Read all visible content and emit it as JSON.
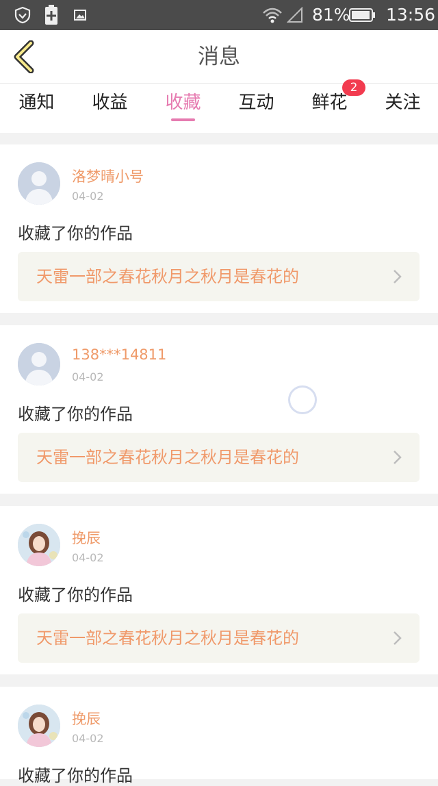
{
  "status_bar": {
    "battery_percent": "81%",
    "time": "13:56",
    "icons": [
      "shield-icon",
      "battery-charging-icon",
      "image-icon",
      "wifi-icon",
      "signal-icon",
      "battery-icon"
    ]
  },
  "header": {
    "title": "消息",
    "back_icon": "chevron-left-icon"
  },
  "tabs": [
    {
      "label": "通知",
      "active": false
    },
    {
      "label": "收益",
      "active": false
    },
    {
      "label": "收藏",
      "active": true
    },
    {
      "label": "互动",
      "active": false
    },
    {
      "label": "鲜花",
      "active": false,
      "badge": "2"
    },
    {
      "label": "关注",
      "active": false
    }
  ],
  "colors": {
    "accent": "#e67bb0",
    "name": "#ef9a69",
    "work_title": "#f0996a",
    "badge": "#f23b4f"
  },
  "items": [
    {
      "name": "洛梦晴小号",
      "date": "04-02",
      "action": "收藏了你的作品",
      "work": "天雷一部之春花秋月之秋月是春花的",
      "avatar": "default-avatar"
    },
    {
      "name": "138***14811",
      "date": "04-02",
      "action": "收藏了你的作品",
      "work": "天雷一部之春花秋月之秋月是春花的",
      "avatar": "default-avatar"
    },
    {
      "name": "挽辰",
      "date": "04-02",
      "action": "收藏了你的作品",
      "work": "天雷一部之春花秋月之秋月是春花的",
      "avatar": "photo-avatar"
    },
    {
      "name": "挽辰",
      "date": "04-02",
      "action": "收藏了你的作品",
      "work": "",
      "avatar": "photo-avatar"
    }
  ]
}
